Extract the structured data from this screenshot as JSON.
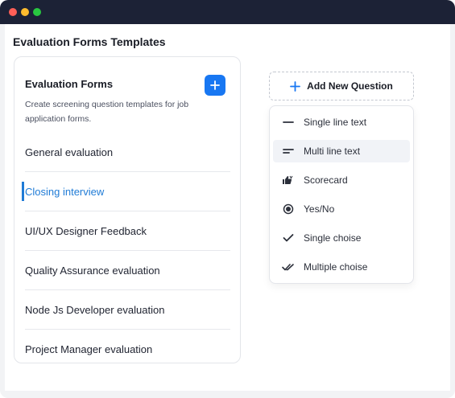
{
  "page": {
    "title": "Evaluation Forms Templates"
  },
  "card": {
    "title": "Evaluation Forms",
    "description": "Create screening question templates for job application forms.",
    "add_icon": "plus-icon",
    "items": [
      {
        "label": "General evaluation",
        "active": false
      },
      {
        "label": "Closing interview",
        "active": true
      },
      {
        "label": "UI/UX Designer Feedback",
        "active": false
      },
      {
        "label": "Quality Assurance evaluation",
        "active": false
      },
      {
        "label": "Node Js Developer evaluation",
        "active": false
      },
      {
        "label": "Project Manager evaluation",
        "active": false
      }
    ]
  },
  "add_question": {
    "label": "Add New Question",
    "icon": "plus-icon"
  },
  "dropdown": {
    "options": [
      {
        "label": "Single line text",
        "icon": "single-line-icon"
      },
      {
        "label": "Multi line text",
        "icon": "multi-line-icon",
        "highlighted": true
      },
      {
        "label": "Scorecard",
        "icon": "thumbs-icon"
      },
      {
        "label": "Yes/No",
        "icon": "radio-icon"
      },
      {
        "label": "Single choise",
        "icon": "check-icon"
      },
      {
        "label": "Multiple choise",
        "icon": "double-check-icon"
      }
    ]
  },
  "colors": {
    "accent": "#1877f2",
    "active_text": "#1f7bd6",
    "titlebar": "#1c2236"
  }
}
